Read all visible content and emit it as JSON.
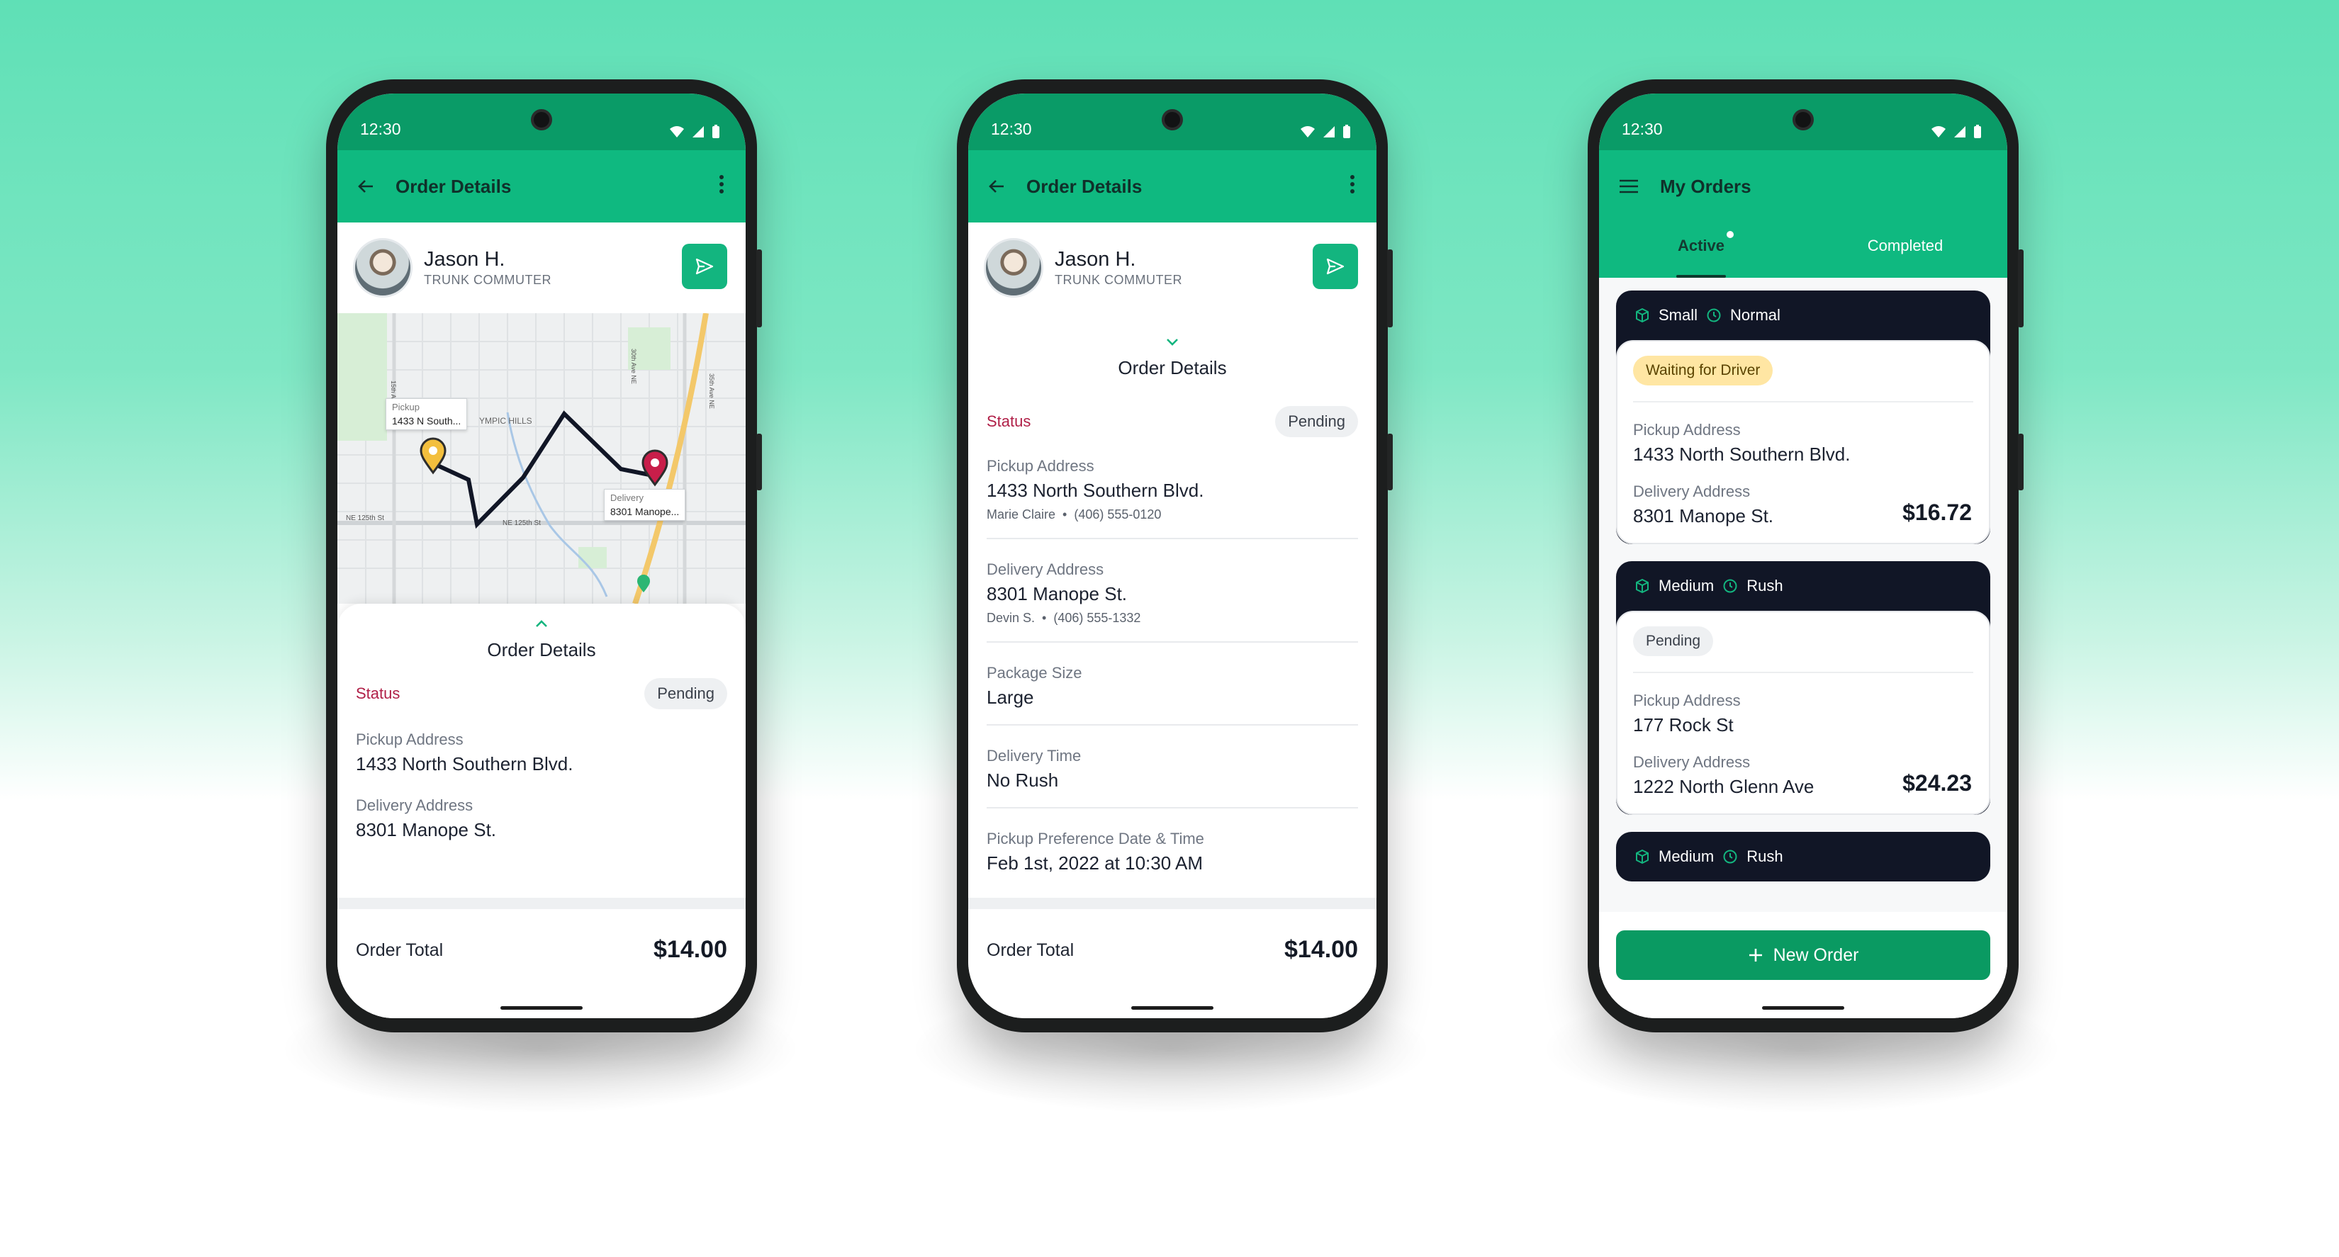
{
  "status_bar": {
    "time": "12:30"
  },
  "phone1": {
    "appbar_title": "Order Details",
    "user_name": "Jason H.",
    "user_role": "TRUNK COMMUTER",
    "map": {
      "pickup_label": "Pickup",
      "pickup_address": "1433 N South...",
      "delivery_label": "Delivery",
      "delivery_address": "8301 Manope...",
      "area_label": "YMPIC HILLS",
      "street1": "NE 125th St",
      "street2": "NE 125th St",
      "street3": "15th Ave NE",
      "street4": "30th Ave NE",
      "street5": "35th Ave NE"
    },
    "sheet_title": "Order Details",
    "status_label": "Status",
    "status_value": "Pending",
    "pickup_label": "Pickup Address",
    "pickup_value": "1433 North Southern Blvd.",
    "delivery_label": "Delivery Address",
    "delivery_value": "8301 Manope St.",
    "total_label": "Order Total",
    "total_value": "$14.00"
  },
  "phone2": {
    "appbar_title": "Order Details",
    "user_name": "Jason H.",
    "user_role": "TRUNK COMMUTER",
    "sheet_title": "Order Details",
    "status_label": "Status",
    "status_value": "Pending",
    "pickup_label": "Pickup Address",
    "pickup_value": "1433 North Southern Blvd.",
    "pickup_contact": "Marie Claire",
    "pickup_phone": "(406) 555-0120",
    "delivery_label": "Delivery Address",
    "delivery_value": "8301 Manope St.",
    "delivery_contact": "Devin S.",
    "delivery_phone": "(406) 555-1332",
    "package_label": "Package Size",
    "package_value": "Large",
    "time_label": "Delivery Time",
    "time_value": "No Rush",
    "pref_label": "Pickup Preference Date & Time",
    "pref_value": "Feb 1st, 2022 at 10:30 AM",
    "total_label": "Order Total",
    "total_value": "$14.00"
  },
  "phone3": {
    "appbar_title": "My Orders",
    "tabs": [
      "Active",
      "Completed"
    ],
    "orders": [
      {
        "size": "Small",
        "speed": "Normal",
        "status": "Waiting for Driver",
        "pickup_label": "Pickup Address",
        "pickup": "1433 North Southern Blvd.",
        "delivery_label": "Delivery Address",
        "delivery": "8301 Manope St.",
        "price": "$16.72"
      },
      {
        "size": "Medium",
        "speed": "Rush",
        "status": "Pending",
        "pickup_label": "Pickup Address",
        "pickup": "177 Rock St",
        "delivery_label": "Delivery Address",
        "delivery": "1222 North Glenn Ave",
        "price": "$24.23"
      },
      {
        "size": "Medium",
        "speed": "Rush"
      }
    ],
    "new_order": "New Order"
  },
  "colors": {
    "primary": "#0fb980",
    "status_bar": "#0a9b67",
    "card_dark": "#111626",
    "status_red": "#b01f47",
    "badge_yellow": "#ffe6a3"
  }
}
